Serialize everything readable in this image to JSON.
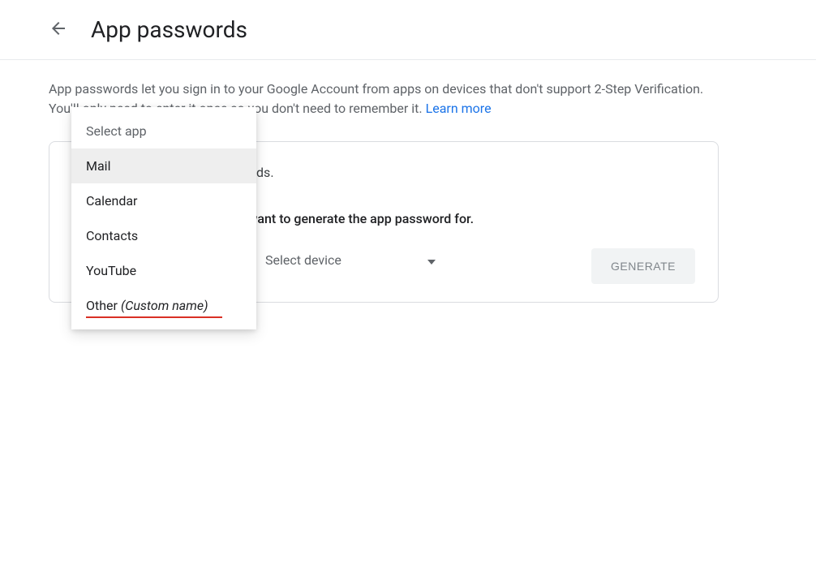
{
  "header": {
    "title": "App passwords"
  },
  "description": {
    "text": "App passwords let you sign in to your Google Account from apps on devices that don't support 2-Step Verification. You'll only need to enter it once so you don't need to remember it. ",
    "learn_more": "Learn more"
  },
  "card": {
    "no_passwords": "You don't have any app passwords.",
    "instruction": "Select the app and device you want to generate the app password for.",
    "select_app_label": "Select app",
    "select_device_label": "Select device",
    "generate_label": "GENERATE"
  },
  "dropdown": {
    "placeholder": "Select app",
    "options": {
      "mail": "Mail",
      "calendar": "Calendar",
      "contacts": "Contacts",
      "youtube": "YouTube",
      "other_prefix": "Other ",
      "other_custom": "(Custom name)"
    }
  }
}
